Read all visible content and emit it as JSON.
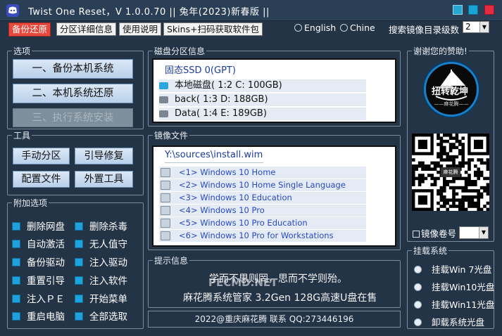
{
  "window": {
    "title": "Twist One Reset，V 1.0.0.70   ||  兔年(2023)新春版  ||"
  },
  "tabs": [
    {
      "label": "备份还原",
      "active": true
    },
    {
      "label": "分区详细信息"
    },
    {
      "label": "使用说明"
    },
    {
      "label": "Skins+扫码获取软件包"
    }
  ],
  "language": {
    "english_label": "English",
    "chinese_label": "Chine"
  },
  "search_depth": {
    "label": "搜索镜像目录级数",
    "value": "2"
  },
  "options": {
    "title": "选项",
    "backup_label": "一、备份本机系统",
    "restore_label": "二、本机系统还原",
    "install_label": "三、执行系统安装"
  },
  "tools": {
    "title": "工具",
    "manual_partition": "手动分区",
    "boot_repair": "引导修复",
    "config_file": "配置文件",
    "external_tools": "外置工具"
  },
  "extra": {
    "title": "附加选项",
    "items": [
      "删除网盘",
      "删除杀毒",
      "自动激活",
      "无人值守",
      "备份驱动",
      "注入驱动",
      "重置引导",
      "注入软件",
      "注入ＰＥ",
      "开始菜单",
      "重启电脑",
      "全部选取"
    ]
  },
  "disk": {
    "title": "磁盘分区信息",
    "header": "固态SSD 0(GPT)",
    "rows": [
      {
        "label": "本地磁盘( 1:2 C: 100GB)",
        "icon": "windows-drive-icon",
        "color": "#2aa7df"
      },
      {
        "label": "back( 1:3 D: 188GB)",
        "icon": "drive-icon",
        "color": "#7a8591"
      },
      {
        "label": "Data( 1:4 E: 189GB)",
        "icon": "drive-icon",
        "color": "#7a8591"
      }
    ]
  },
  "image": {
    "title": "镜像文件",
    "path": "Y:\\sources\\install.wim",
    "rows": [
      "<1> Windows 10 Home",
      "<2> Windows 10 Home Single Language",
      "<3> Windows 10 Education",
      "<4> Windows 10 Pro",
      "<5> Windows 10 Pro Education",
      "<6> Windows 10 Pro for Workstations"
    ]
  },
  "tips": {
    "title": "提示信息",
    "line1": "学而不思则罔，思而不学则殆。",
    "line2": "麻花腾系统管家 3.2Gen 128G高速U盘在售",
    "watermark": "PECMD.NET",
    "footer": "2022@重庆麻花腾 联系 QQ:273446196"
  },
  "thanks": {
    "title": "谢谢您的赞助!",
    "logo_text": "扭转乾坤",
    "logo_sub": "——麻花腾——",
    "qr_center": "麻花腾"
  },
  "volume": {
    "label": "镜像卷号",
    "value": ""
  },
  "mount": {
    "title": "挂载系统",
    "items": [
      "挂载Win  7光盘",
      "挂载Win10光盘",
      "挂载Win11光盘",
      "卸载系统光盘"
    ]
  },
  "colors": {
    "background": "#243447",
    "accent_tab": "#e8473c",
    "checkbox": "#1fa2dc",
    "close_button": "#e52b3f"
  }
}
